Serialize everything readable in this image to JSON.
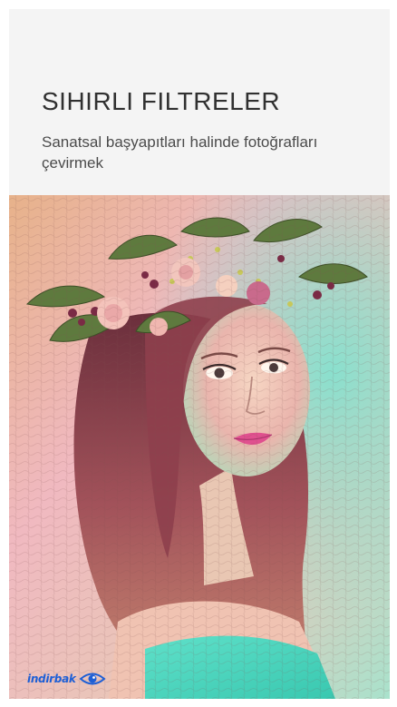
{
  "header": {
    "title": "SIHIRLI FILTRELER",
    "subtitle": "Sanatsal başyapıtları halinde fotoğrafları çevirmek"
  },
  "artwork": {
    "subject": "portrait-with-flower-crown",
    "palette": {
      "background_warm": "#e3b58f",
      "background_pink": "#f1b6c5",
      "background_mint": "#8fe0c8",
      "hair": "#9a4a52",
      "skin": "#f0c9b6",
      "lips": "#e0508f",
      "dress": "#59dfc6",
      "leaf": "#5e7a3e",
      "flower": "#f0b9b6"
    }
  },
  "brand": {
    "name": "indirbak",
    "icon": "eye-logo",
    "color": "#1d5fd6"
  }
}
